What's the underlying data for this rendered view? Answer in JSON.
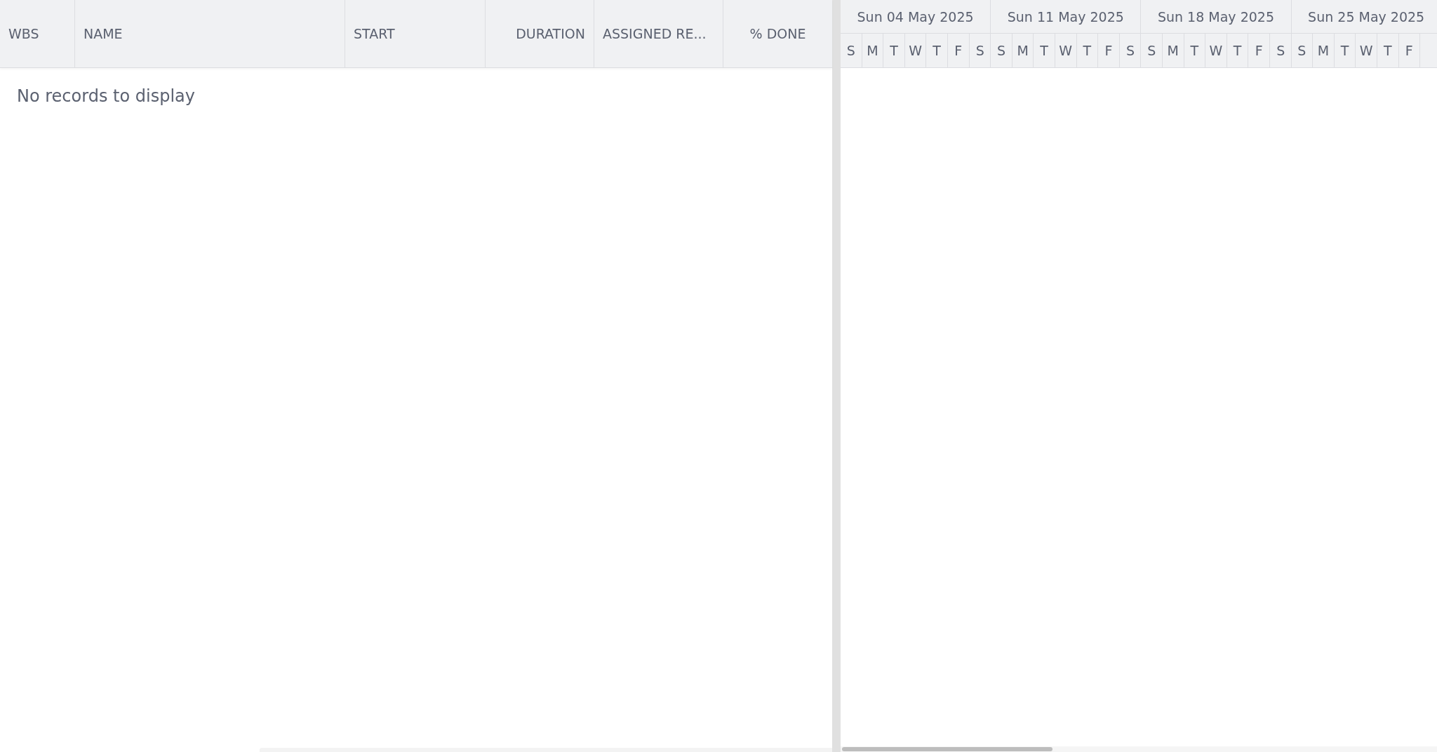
{
  "grid": {
    "columns": [
      {
        "label": "WBS"
      },
      {
        "label": "NAME"
      },
      {
        "label": "START"
      },
      {
        "label": "DURATION"
      },
      {
        "label": "ASSIGNED RE..."
      },
      {
        "label": "% DONE"
      }
    ],
    "empty_message": "No records to display"
  },
  "timeline": {
    "weeks": [
      {
        "label": "Sun 04 May 2025",
        "days": [
          "S",
          "M",
          "T",
          "W",
          "T",
          "F",
          "S"
        ]
      },
      {
        "label": "Sun 11 May 2025",
        "days": [
          "S",
          "M",
          "T",
          "W",
          "T",
          "F",
          "S"
        ]
      },
      {
        "label": "Sun 18 May 2025",
        "days": [
          "S",
          "M",
          "T",
          "W",
          "T",
          "F",
          "S"
        ]
      },
      {
        "label": "Sun 25 May 2025",
        "days": [
          "S",
          "M",
          "T",
          "W",
          "T",
          "F"
        ]
      }
    ]
  }
}
